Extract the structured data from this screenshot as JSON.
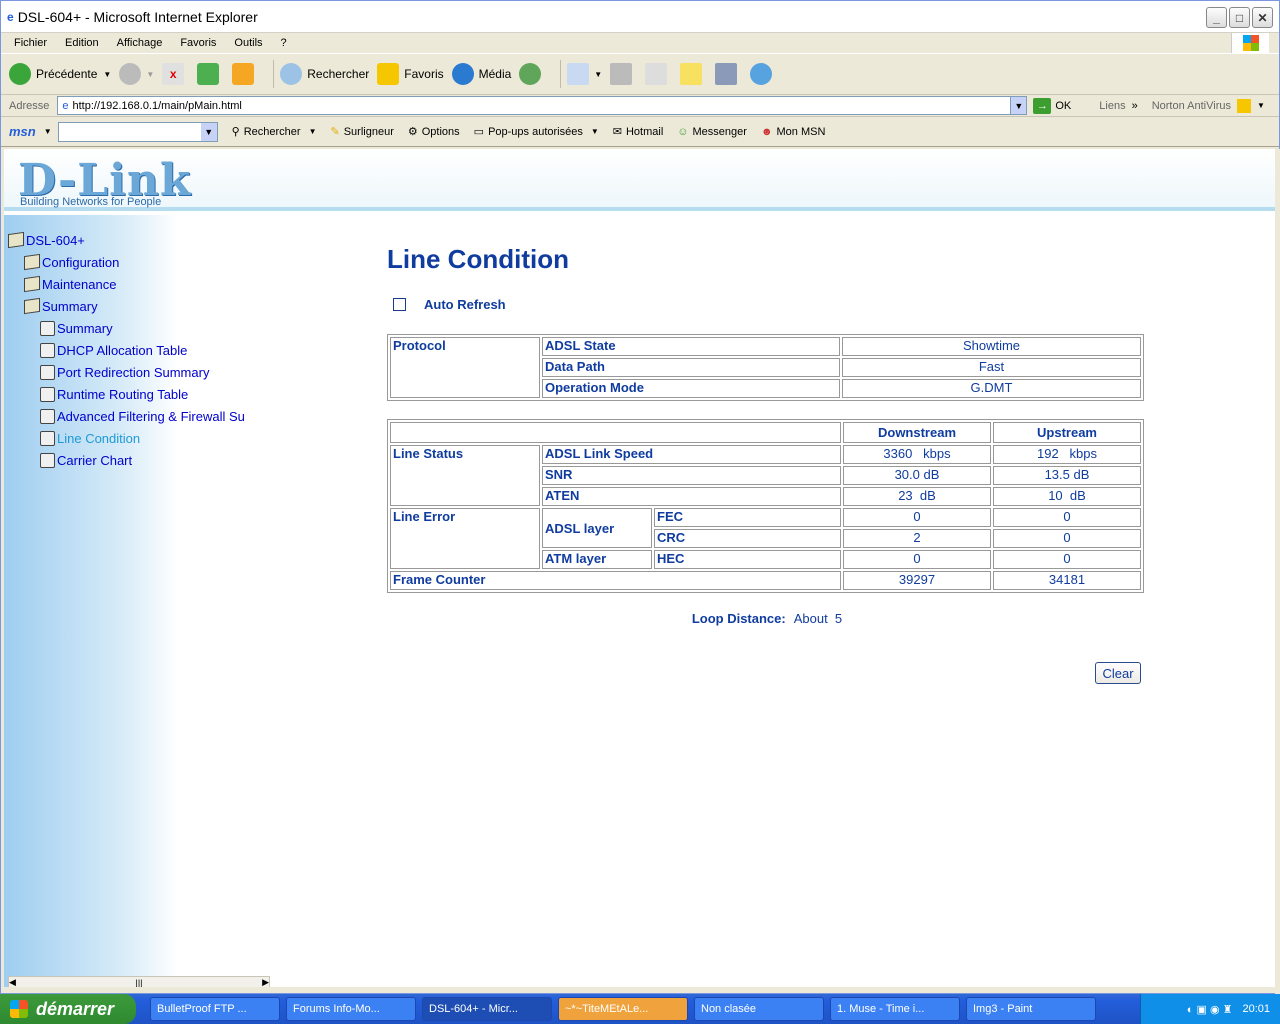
{
  "window": {
    "title": "DSL-604+ - Microsoft Internet Explorer"
  },
  "menu": [
    "Fichier",
    "Edition",
    "Affichage",
    "Favoris",
    "Outils",
    "?"
  ],
  "toolbar": {
    "back": "Précédente",
    "search": "Rechercher",
    "favorites": "Favoris",
    "media": "Média"
  },
  "address": {
    "label": "Adresse",
    "url": "http://192.168.0.1/main/pMain.html",
    "go": "OK",
    "links": "Liens",
    "norton": "Norton AntiVirus"
  },
  "msn": {
    "logo": "msn",
    "search": "Rechercher",
    "highlight": "Surligneur",
    "options": "Options",
    "popups": "Pop-ups autorisées",
    "hotmail": "Hotmail",
    "messenger": "Messenger",
    "mymsn": "Mon MSN"
  },
  "brand": {
    "logo": "D-Link",
    "tagline": "Building Networks for People"
  },
  "tree": [
    {
      "label": "DSL-604+",
      "level": 0,
      "type": "folder"
    },
    {
      "label": "Configuration",
      "level": 1,
      "type": "folder"
    },
    {
      "label": "Maintenance",
      "level": 1,
      "type": "folder"
    },
    {
      "label": "Summary",
      "level": 1,
      "type": "folder"
    },
    {
      "label": "Summary",
      "level": 2,
      "type": "page"
    },
    {
      "label": "DHCP Allocation Table",
      "level": 2,
      "type": "page"
    },
    {
      "label": "Port Redirection Summary",
      "level": 2,
      "type": "page"
    },
    {
      "label": "Runtime Routing Table",
      "level": 2,
      "type": "page"
    },
    {
      "label": "Advanced Filtering & Firewall Su",
      "level": 2,
      "type": "page"
    },
    {
      "label": "Line Condition",
      "level": 2,
      "type": "page",
      "active": true
    },
    {
      "label": "Carrier Chart",
      "level": 2,
      "type": "page"
    }
  ],
  "page": {
    "title": "Line Condition",
    "auto_refresh": "Auto Refresh",
    "protocol": {
      "label": "Protocol",
      "rows": [
        [
          "ADSL State",
          "Showtime"
        ],
        [
          "Data Path",
          "Fast"
        ],
        [
          "Operation Mode",
          "G.DMT"
        ]
      ]
    },
    "status": {
      "downstream": "Downstream",
      "upstream": "Upstream",
      "line_status": "Line Status",
      "link_speed": {
        "label": "ADSL Link Speed",
        "down": "3360   kbps",
        "up": "192   kbps"
      },
      "snr": {
        "label": "SNR",
        "down": "30.0 dB",
        "up": "13.5 dB"
      },
      "aten": {
        "label": "ATEN",
        "down": "23  dB",
        "up": "10  dB"
      },
      "line_error": "Line Error",
      "adsl_layer": "ADSL layer",
      "atm_layer": "ATM layer",
      "fec": {
        "label": "FEC",
        "down": "0",
        "up": "0"
      },
      "crc": {
        "label": "CRC",
        "down": "2",
        "up": "0"
      },
      "hec": {
        "label": "HEC",
        "down": "0",
        "up": "0"
      },
      "frame": {
        "label": "Frame Counter",
        "down": "39297",
        "up": "34181"
      }
    },
    "loop_label": "Loop Distance:",
    "loop_value": "About  5",
    "clear": "Clear"
  },
  "taskbar": {
    "start": "démarrer",
    "tasks": [
      "BulletProof FTP ...",
      "Forums Info-Mo...",
      "DSL-604+ - Micr...",
      "~*~TiteMEtALe...",
      "Non clasée",
      "1. Muse - Time i...",
      "Img3 - Paint"
    ],
    "clock": "20:01"
  }
}
